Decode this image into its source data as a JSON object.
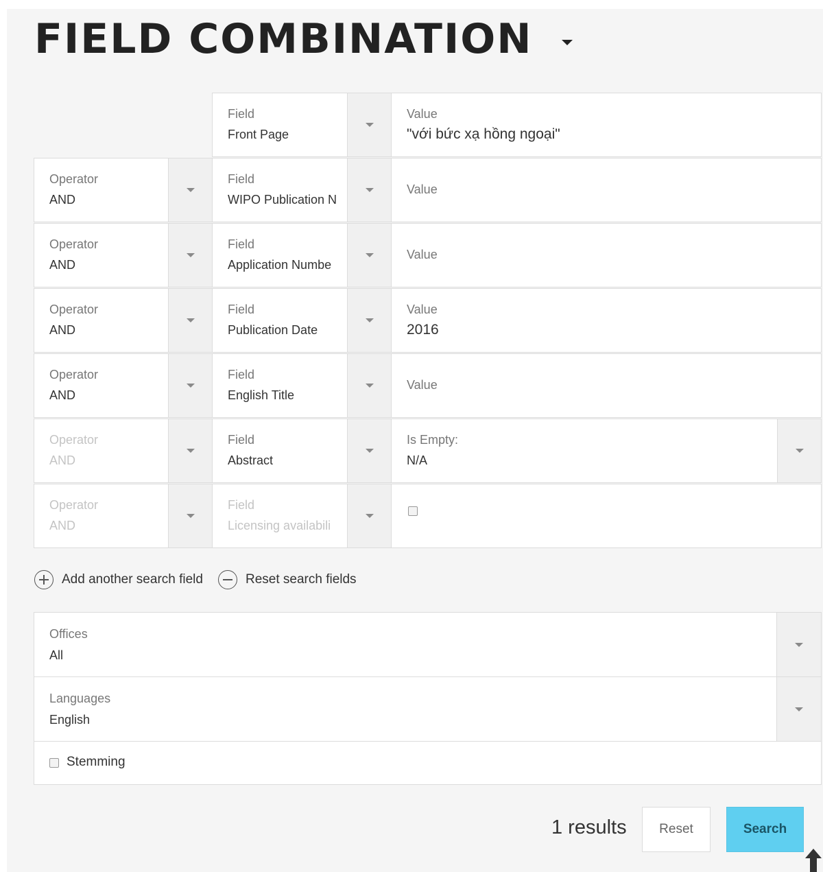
{
  "header": {
    "title": "FIELD COMBINATION"
  },
  "rows": [
    {
      "operator_label": "",
      "operator_value": "",
      "field_label": "Field",
      "field_value": "Front Page",
      "value_label": "Value",
      "value": "\"với bức xạ hồng ngoại\""
    },
    {
      "operator_label": "Operator",
      "operator_value": "AND",
      "field_label": "Field",
      "field_value": "WIPO Publication N",
      "value_label": "Value",
      "value": ""
    },
    {
      "operator_label": "Operator",
      "operator_value": "AND",
      "field_label": "Field",
      "field_value": "Application Numbe",
      "value_label": "Value",
      "value": ""
    },
    {
      "operator_label": "Operator",
      "operator_value": "AND",
      "field_label": "Field",
      "field_value": "Publication Date",
      "value_label": "Value",
      "value": "2016"
    },
    {
      "operator_label": "Operator",
      "operator_value": "AND",
      "field_label": "Field",
      "field_value": "English Title",
      "value_label": "Value",
      "value": ""
    },
    {
      "operator_label": "Operator",
      "operator_value": "AND",
      "field_label": "Field",
      "field_value": "Abstract",
      "value_label": "Is Empty:",
      "value": "N/A"
    },
    {
      "operator_label": "Operator",
      "operator_value": "AND",
      "field_label": "Field",
      "field_value": "Licensing availabili",
      "value_label": "",
      "value": ""
    }
  ],
  "actions": {
    "add_label": "Add another search field",
    "reset_label": "Reset search fields"
  },
  "options": {
    "offices_label": "Offices",
    "offices_value": "All",
    "languages_label": "Languages",
    "languages_value": "English",
    "stemming_label": "Stemming"
  },
  "footer": {
    "results_text": "1 results",
    "reset_button": "Reset",
    "search_button": "Search"
  },
  "colors": {
    "search_button": "#5fcff0",
    "page_bg": "#f5f5f5"
  }
}
